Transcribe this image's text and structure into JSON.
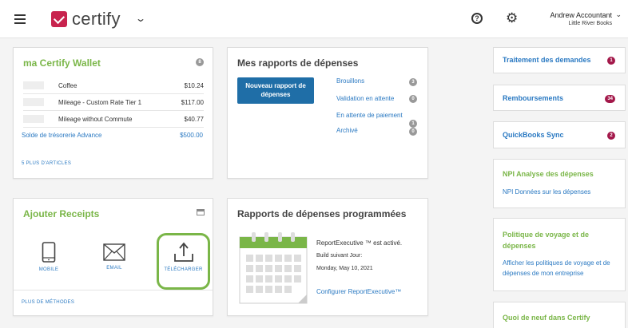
{
  "header": {
    "logo_text": "certify",
    "user_name": "Andrew Accountant",
    "user_company": "Little River Books"
  },
  "wallet": {
    "title": "ma Certify Wallet",
    "badge": "8",
    "items": [
      {
        "desc": "Coffee",
        "amount": "$10.24"
      },
      {
        "desc": "Mileage - Custom Rate Tier 1",
        "amount": "$117.00"
      },
      {
        "desc": "Mileage without Commute",
        "amount": "$40.77"
      }
    ],
    "advance_label": "Solde de trésorerie Advance",
    "advance_amount": "$500.00",
    "more_link": "5 PLUS D'ARTICLES"
  },
  "expense_reports": {
    "title": "Mes rapports de dépenses",
    "new_button": "Nouveau rapport de dépenses",
    "statuses": [
      {
        "label": "Brouillons",
        "count": "3"
      },
      {
        "label": "Validation en attente",
        "count": "0"
      },
      {
        "label": "En attente de paiement",
        "count": "1"
      },
      {
        "label": "Archivé",
        "count": "0"
      }
    ]
  },
  "receipts": {
    "title": "Ajouter Receipts",
    "options": [
      {
        "label": "MOBILE",
        "icon": "mobile-phone-icon"
      },
      {
        "label": "EMAIL",
        "icon": "envelope-icon"
      },
      {
        "label": "TÉLÉCHARGER",
        "icon": "upload-icon"
      }
    ],
    "more_methods": "PLUS DE MÉTHODES",
    "highlight_color": "#7ab648"
  },
  "scheduled": {
    "title": "Rapports de dépenses programmées",
    "status_line": "ReportExecutive ™ est activé.",
    "next_build_label": "Build suivant Jour:",
    "next_build_date": "Monday, May 10, 2021",
    "configure_link": "Configurer ReportExecutive™"
  },
  "sidebar": {
    "requests": {
      "label": "Traitement des demandes",
      "count": "1"
    },
    "reimbursements": {
      "label": "Remboursements",
      "count": "34"
    },
    "quickbooks": {
      "label": "QuickBooks Sync",
      "count": "2"
    },
    "analysis": {
      "title": "NPI Analyse des dépenses",
      "link": "NPI Données sur les dépenses"
    },
    "policy": {
      "title": "Politique de voyage et de dépenses",
      "link": "Afficher les politiques de voyage et de dépenses de mon entreprise"
    },
    "news": {
      "title": "Quoi de neuf dans Certify"
    }
  },
  "colors": {
    "brand": "#c8234e",
    "accent_green": "#7ab648",
    "link_blue": "#2a79c2",
    "button_blue": "#1f6ea7",
    "badge_red": "#a3184a"
  }
}
